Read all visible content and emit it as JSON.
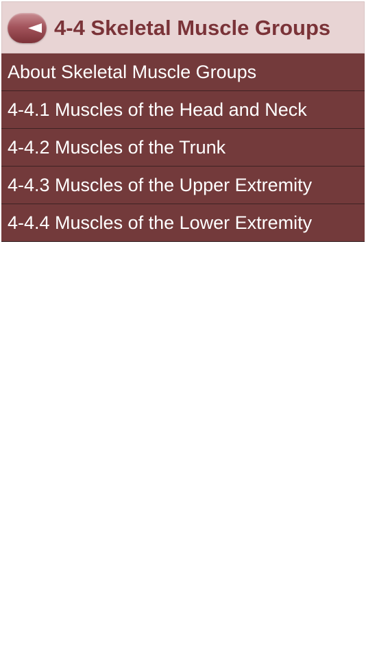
{
  "header": {
    "title": "4-4 Skeletal Muscle Groups",
    "back_icon": "back-arrow-icon"
  },
  "menu": {
    "items": [
      {
        "label": "About Skeletal Muscle Groups"
      },
      {
        "label": "4-4.1 Muscles of the Head and Neck"
      },
      {
        "label": "4-4.2 Muscles of the Trunk"
      },
      {
        "label": "4-4.3 Muscles of the Upper Extremity"
      },
      {
        "label": "4-4.4 Muscles of the Lower Extremity"
      }
    ]
  },
  "colors": {
    "header_bg": "#e8d4d4",
    "title": "#7a3338",
    "item_bg": "#733a3b",
    "item_text": "#ffffff"
  }
}
